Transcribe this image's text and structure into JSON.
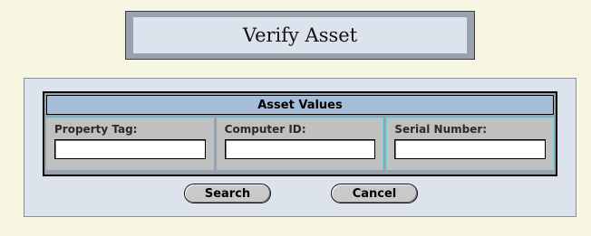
{
  "page": {
    "title": "Verify Asset"
  },
  "asset_values": {
    "header": "Asset Values",
    "fields": [
      {
        "label": "Property Tag:",
        "value": ""
      },
      {
        "label": "Computer ID:",
        "value": ""
      },
      {
        "label": "Serial Number:",
        "value": ""
      }
    ]
  },
  "actions": {
    "search_label": "Search",
    "cancel_label": "Cancel"
  }
}
